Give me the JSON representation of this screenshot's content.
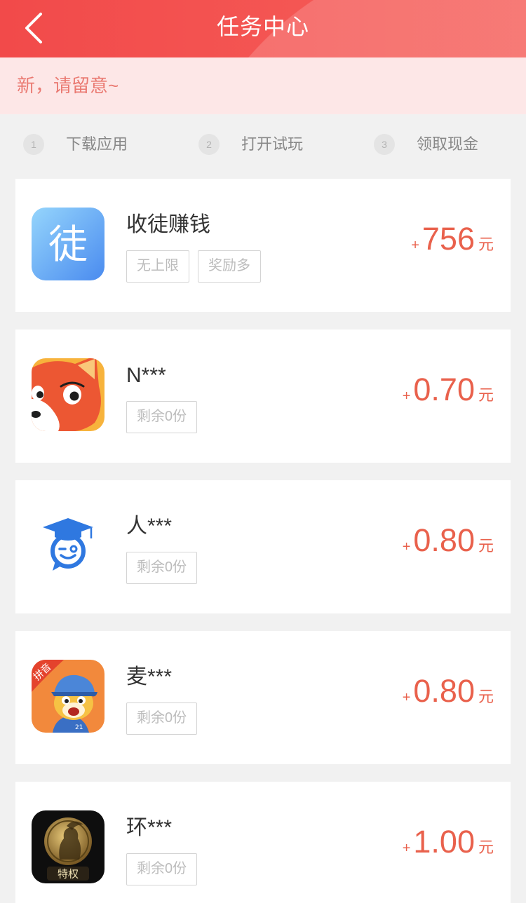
{
  "header": {
    "title": "任务中心",
    "back_icon": "chevron-left-icon"
  },
  "notice": {
    "text": "新，请留意~"
  },
  "steps": [
    {
      "num": "1",
      "label": "下载应用"
    },
    {
      "num": "2",
      "label": "打开试玩"
    },
    {
      "num": "3",
      "label": "领取现金"
    }
  ],
  "tasks": [
    {
      "name": "收徒赚钱",
      "icon": "apprentice-icon",
      "icon_text": "徒",
      "tags": [
        "无上限",
        "奖励多"
      ],
      "plus": "+",
      "amount": "756",
      "unit": "元"
    },
    {
      "name": "N***",
      "icon": "fox-app-icon",
      "tags": [
        "剩余0份"
      ],
      "plus": "+",
      "amount": "0.70",
      "unit": "元"
    },
    {
      "name": "人***",
      "icon": "graduation-chat-icon",
      "tags": [
        "剩余0份"
      ],
      "plus": "+",
      "amount": "0.80",
      "unit": "元"
    },
    {
      "name": "麦***",
      "icon": "pinyin-kid-app-icon",
      "logo_text": "拼音",
      "logo_number": "21",
      "tags": [
        "剩余0份"
      ],
      "plus": "+",
      "amount": "0.80",
      "unit": "元"
    },
    {
      "name": "环***",
      "icon": "coin-warrior-app-icon",
      "logo_text": "特权",
      "tags": [
        "剩余0份"
      ],
      "plus": "+",
      "amount": "1.00",
      "unit": "元"
    }
  ],
  "colors": {
    "header_start": "#f24a4a",
    "header_end": "#f55f5a",
    "notice_bg": "#fde7e7",
    "notice_text": "#ea7a72",
    "accent": "#e9614c",
    "page_bg": "#f1f1f1"
  }
}
